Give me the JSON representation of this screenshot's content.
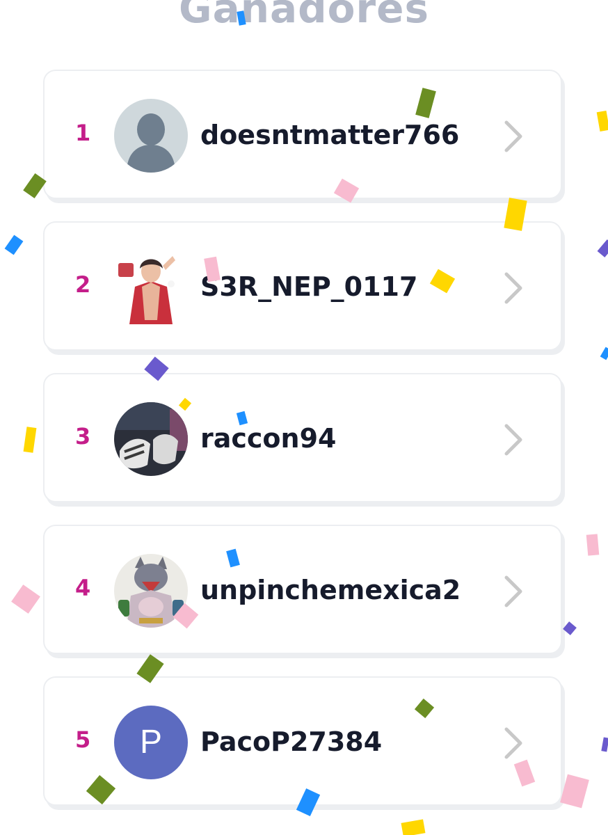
{
  "header": {
    "title": "Ganadores"
  },
  "winners": [
    {
      "rank": "1",
      "username": "doesntmatter766",
      "avatar": "default-person"
    },
    {
      "rank": "2",
      "username": "S3R_NEP_0117",
      "avatar": "illustrated-character"
    },
    {
      "rank": "3",
      "username": "raccon94",
      "avatar": "photo"
    },
    {
      "rank": "4",
      "username": "unpinchemexica2",
      "avatar": "illustrated-wolf"
    },
    {
      "rank": "5",
      "username": "PacoP27384",
      "avatar": "letter",
      "avatar_letter": "P"
    }
  ],
  "colors": {
    "title": "#b3b9c8",
    "rank": "#c41e8a",
    "username": "#161b2c",
    "chevron": "#c8c8c8",
    "card_border": "#eceef1",
    "letter_avatar_bg": "#5c6bc0",
    "confetti": [
      "#6b8e23",
      "#ffd700",
      "#f8bbd0",
      "#1e90ff",
      "#6a5acd"
    ]
  },
  "icons": {
    "chevron": "chevron-right-icon",
    "default_avatar": "person-silhouette-icon"
  }
}
